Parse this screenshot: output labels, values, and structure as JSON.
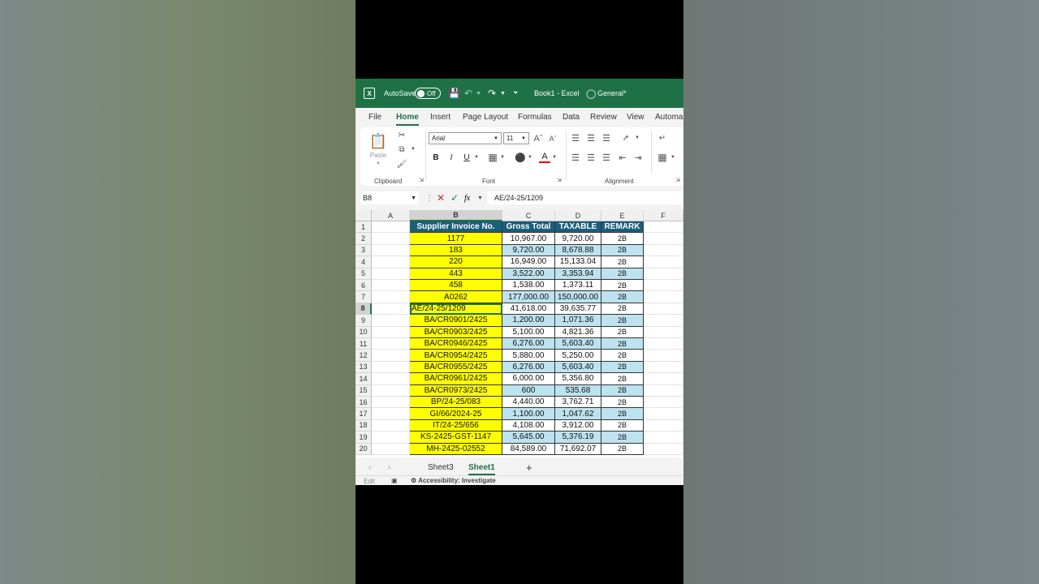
{
  "titlebar": {
    "autosave_label": "AutoSave",
    "autosave_state": "Off",
    "document_title": "Book1  -  Excel",
    "sensitivity_label": "General*",
    "accent_color": "#1e7145"
  },
  "menu": {
    "tabs": [
      "File",
      "Home",
      "Insert",
      "Page Layout",
      "Formulas",
      "Data",
      "Review",
      "View",
      "Automa"
    ],
    "active_tab": "Home"
  },
  "ribbon": {
    "clipboard_label": "Clipboard",
    "paste_label": "Paste",
    "font_label": "Font",
    "font_name": "Arial",
    "font_size": "11",
    "alignment_label": "Alignment",
    "bold": "B",
    "italic": "I",
    "underline": "U"
  },
  "formula_bar": {
    "name_box": "B8",
    "fx": "fx",
    "value": "AE/24-25/1209"
  },
  "grid": {
    "columns": [
      "A",
      "B",
      "C",
      "D",
      "E",
      "F"
    ],
    "selected_column": "B",
    "selected_row": 8,
    "rows": [
      "1",
      "2",
      "3",
      "4",
      "5",
      "6",
      "7",
      "8",
      "9",
      "10",
      "11",
      "12",
      "13",
      "14",
      "15",
      "16",
      "17",
      "18",
      "19",
      "20"
    ],
    "headers": [
      "Supplier Invoice No.",
      "Gross Total",
      "TAXABLE",
      "REMARK"
    ],
    "header_color": "#1b5e7a",
    "invoice_color": "#ffff00",
    "band_color": "#bde2f0",
    "data": [
      [
        "1177",
        "10,967.00",
        "9,720.00",
        "2B"
      ],
      [
        "183",
        "9,720.00",
        "8,678.88",
        "2B"
      ],
      [
        "220",
        "16,949.00",
        "15,133.04",
        "2B"
      ],
      [
        "443",
        "3,522.00",
        "3,353.94",
        "2B"
      ],
      [
        "458",
        "1,538.00",
        "1,373.11",
        "2B"
      ],
      [
        "A0262",
        "177,000.00",
        "150,000.00",
        "2B"
      ],
      [
        "AE/24-25/1209",
        "41,618.00",
        "39,635.77",
        "2B"
      ],
      [
        "BA/CR0901/2425",
        "1,200.00",
        "1,071.36",
        "2B"
      ],
      [
        "BA/CR0903/2425",
        "5,100.00",
        "4,821.36",
        "2B"
      ],
      [
        "BA/CR0946/2425",
        "6,276.00",
        "5,603.40",
        "2B"
      ],
      [
        "BA/CR0954/2425",
        "5,880.00",
        "5,250.00",
        "2B"
      ],
      [
        "BA/CR0955/2425",
        "6,276.00",
        "5,603.40",
        "2B"
      ],
      [
        "BA/CR0961/2425",
        "6,000.00",
        "5,356.80",
        "2B"
      ],
      [
        "BA/CR0973/2425",
        "600",
        "535.68",
        "2B"
      ],
      [
        "BP/24-25/083",
        "4,440.00",
        "3,762.71",
        "2B"
      ],
      [
        "GI/66/2024-25",
        "1,100.00",
        "1,047.62",
        "2B"
      ],
      [
        "IT/24-25/656",
        "4,108.00",
        "3,912.00",
        "2B"
      ],
      [
        "KS-2425-GST-1147",
        "5,645.00",
        "5,376.19",
        "2B"
      ],
      [
        "MH-2425-02552",
        "84,589.00",
        "71,692.07",
        "2B"
      ]
    ]
  },
  "sheets": {
    "tabs": [
      "Sheet3",
      "Sheet1"
    ],
    "active": "Sheet1",
    "add": "+"
  },
  "status": {
    "mode": "Edit",
    "accessibility": "Accessibility: Investigate"
  }
}
